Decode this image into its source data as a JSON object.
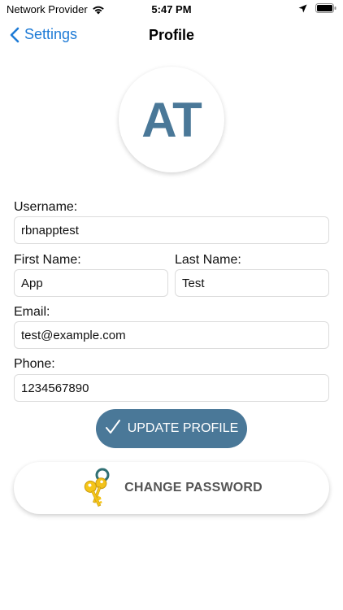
{
  "status_bar": {
    "carrier": "Network Provider",
    "time": "5:47 PM",
    "icons": [
      "wifi-icon",
      "location-arrow-icon",
      "battery-icon"
    ]
  },
  "nav": {
    "back_label": "Settings",
    "title": "Profile",
    "back_icon": "chevron-left-icon",
    "accent_color": "#1e7bd6"
  },
  "avatar": {
    "initials": "AT",
    "color": "#4a7898"
  },
  "form": {
    "username": {
      "label": "Username:",
      "value": "rbnapptest"
    },
    "first_name": {
      "label": "First Name:",
      "value": "App"
    },
    "last_name": {
      "label": "Last Name:",
      "value": "Test"
    },
    "email": {
      "label": "Email:",
      "value": "test@example.com"
    },
    "phone": {
      "label": "Phone:",
      "value": "1234567890"
    }
  },
  "actions": {
    "update_label": "UPDATE PROFILE",
    "update_icon": "checkmark-icon",
    "update_color": "#4a7898",
    "change_password_label": "CHANGE PASSWORD",
    "change_password_icon": "keys-icon"
  }
}
